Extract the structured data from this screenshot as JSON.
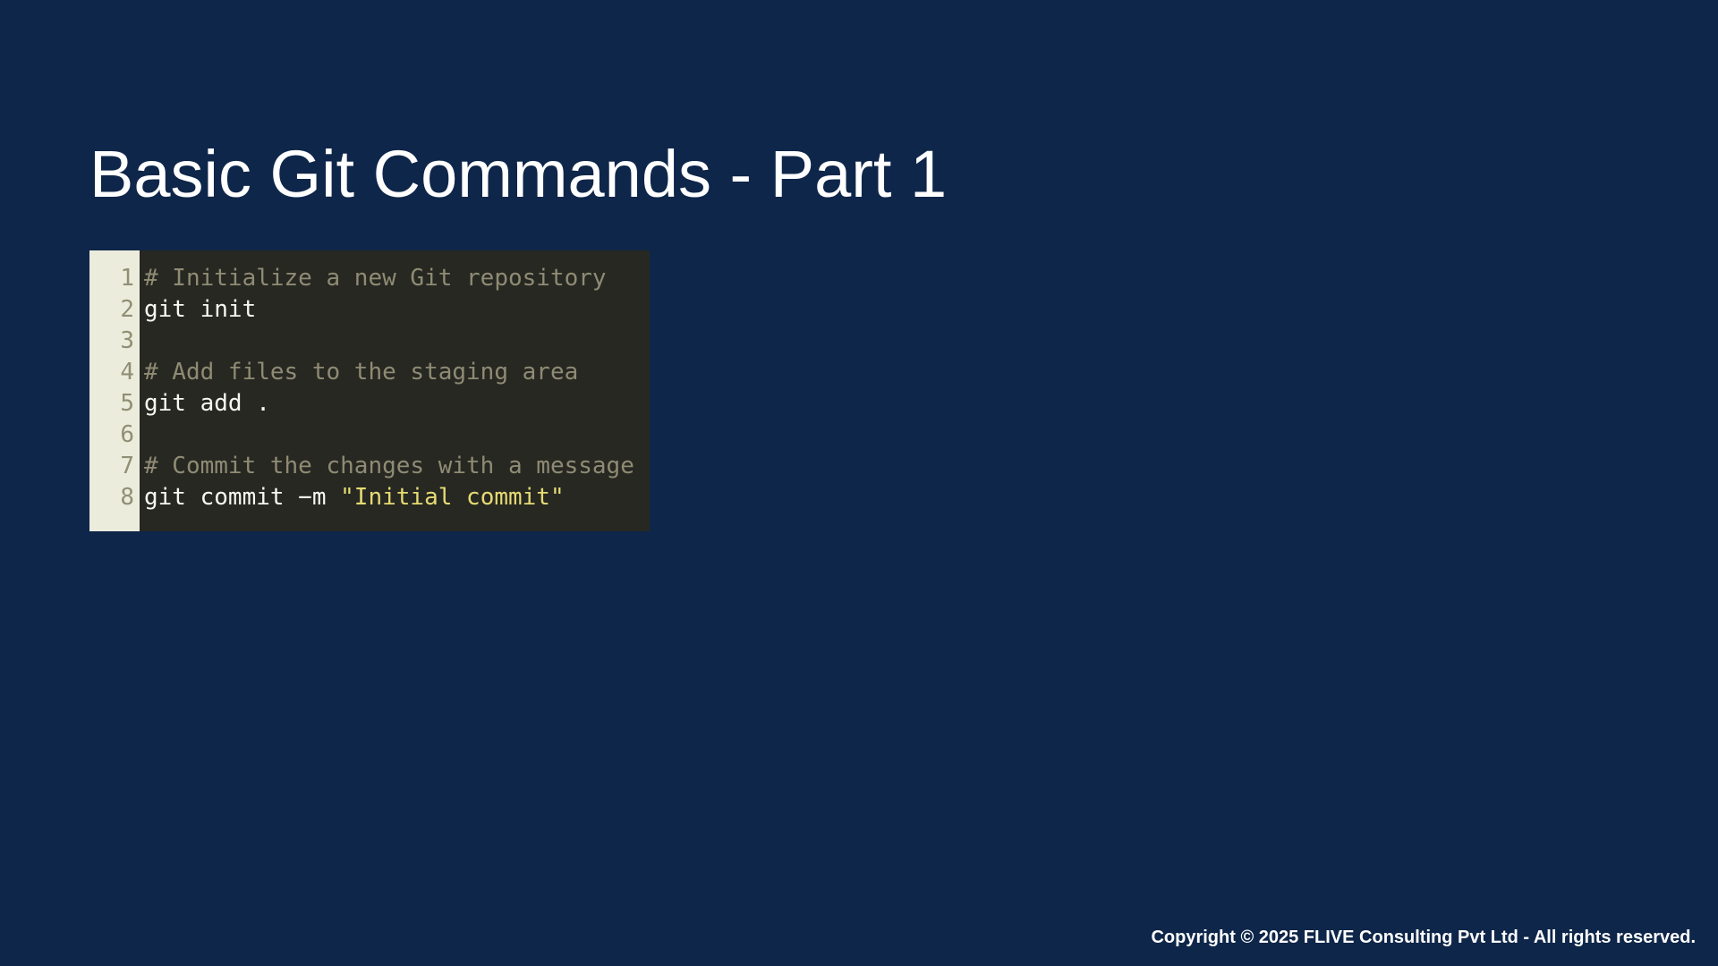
{
  "slide": {
    "title": "Basic Git Commands - Part 1",
    "footer": "Copyright © 2025 FLIVE Consulting Pvt Ltd - All rights reserved."
  },
  "code": {
    "line_numbers": [
      "1",
      "2",
      "3",
      "4",
      "5",
      "6",
      "7",
      "8"
    ],
    "lines": [
      [
        {
          "type": "comment",
          "text": "# Initialize a new Git repository"
        }
      ],
      [
        {
          "type": "plain",
          "text": "git init"
        }
      ],
      [],
      [
        {
          "type": "comment",
          "text": "# Add files to the staging area"
        }
      ],
      [
        {
          "type": "plain",
          "text": "git add ."
        }
      ],
      [],
      [
        {
          "type": "comment",
          "text": "# Commit the changes with a message"
        }
      ],
      [
        {
          "type": "plain",
          "text": "git commit −m "
        },
        {
          "type": "string",
          "text": "\"Initial commit\""
        }
      ]
    ]
  },
  "colors": {
    "background": "#0e2649",
    "code_background": "#272822",
    "gutter_background": "#ececdc",
    "comment": "#8f8b74",
    "plain": "#f8f8f2",
    "string": "#e6db74"
  }
}
